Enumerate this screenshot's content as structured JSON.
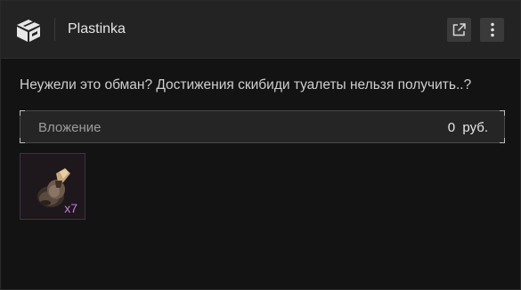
{
  "header": {
    "title": "Plastinka",
    "logo_icon": "box-icon",
    "open_button_icon": "external-link-icon",
    "more_button_icon": "more-vertical-icon"
  },
  "message": {
    "text": "Неужели это обман? Достижения скибиди туалеты нельзя получить..?"
  },
  "attachment": {
    "label": "Вложение",
    "amount": "0  руб."
  },
  "items": [
    {
      "quantity": "x7",
      "icon": "item-icon"
    }
  ],
  "colors": {
    "background": "#131313",
    "header": "#232323",
    "quantity": "#c67fe0"
  }
}
